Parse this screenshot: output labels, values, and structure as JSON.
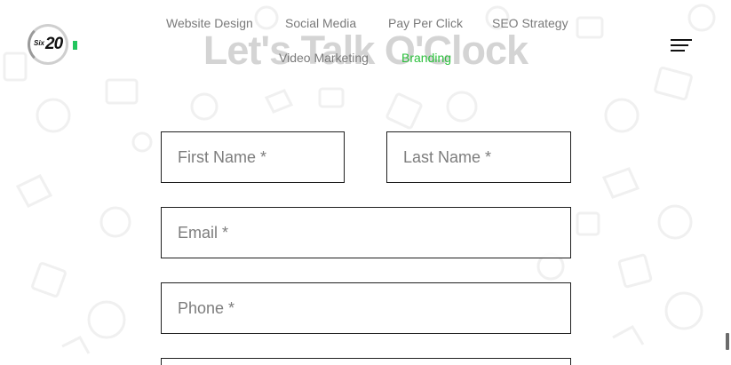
{
  "logo": {
    "six": "Six",
    "twenty": "20"
  },
  "hero": {
    "title": "Let's Talk O'Clock"
  },
  "nav": {
    "items": [
      {
        "label": "Website Design",
        "active": false
      },
      {
        "label": "Social Media",
        "active": false
      },
      {
        "label": "Pay Per Click",
        "active": false
      },
      {
        "label": "SEO Strategy",
        "active": false
      },
      {
        "label": "Video Marketing",
        "active": false
      },
      {
        "label": "Branding",
        "active": true
      }
    ]
  },
  "form": {
    "first_name": {
      "placeholder": "First Name *",
      "value": ""
    },
    "last_name": {
      "placeholder": "Last Name *",
      "value": ""
    },
    "email": {
      "placeholder": "Email *",
      "value": ""
    },
    "phone": {
      "placeholder": "Phone *",
      "value": ""
    }
  },
  "colors": {
    "accent": "#2bc03c",
    "nav_text": "#7a7a7a",
    "field_border": "#1f1f1f",
    "hero_text": "#d4d4d4"
  },
  "icons": [
    "hamburger-menu-icon",
    "logo-clock-icon"
  ]
}
